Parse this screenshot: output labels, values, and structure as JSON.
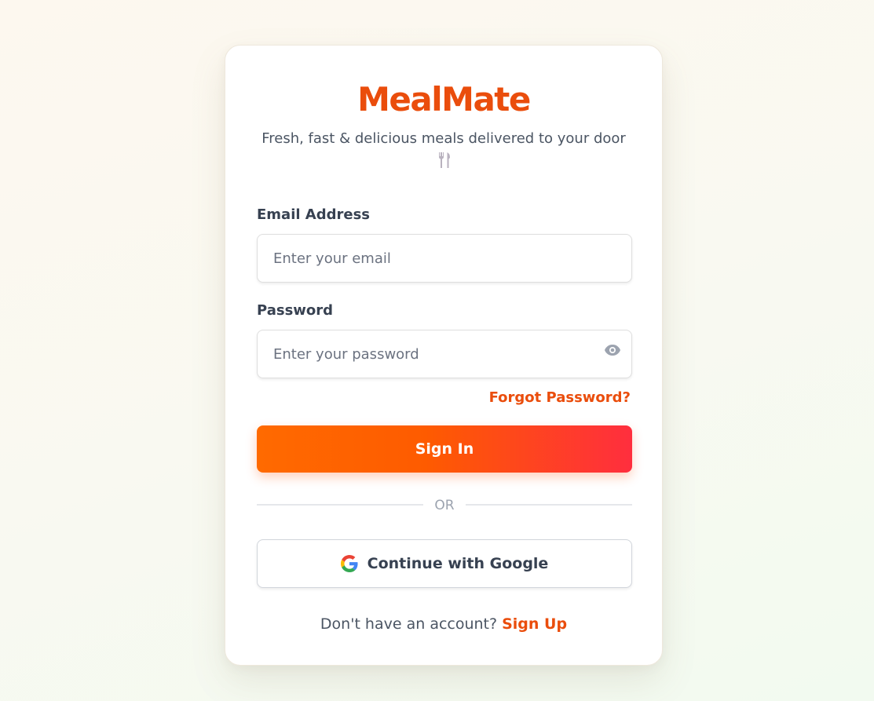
{
  "brand": {
    "name": "MealMate",
    "tagline": "Fresh, fast & delicious meals delivered to your door",
    "tagline_icon": "fork-knife-icon",
    "color": "#ea4d0c"
  },
  "form": {
    "email": {
      "label": "Email Address",
      "placeholder": "Enter your email",
      "value": ""
    },
    "password": {
      "label": "Password",
      "placeholder": "Enter your password",
      "value": "",
      "toggle_icon": "eye-icon"
    },
    "forgot_password_label": "Forgot Password?",
    "submit_label": "Sign In"
  },
  "divider": {
    "label": "OR"
  },
  "social": {
    "google_label": "Continue with Google",
    "google_icon": "google-icon"
  },
  "footer": {
    "prompt": "Don't have an account?",
    "signup_label": "Sign Up"
  },
  "colors": {
    "accent": "#ea4d0c",
    "button_gradient_start": "#ff6a00",
    "button_gradient_end": "#ff2e3e"
  }
}
